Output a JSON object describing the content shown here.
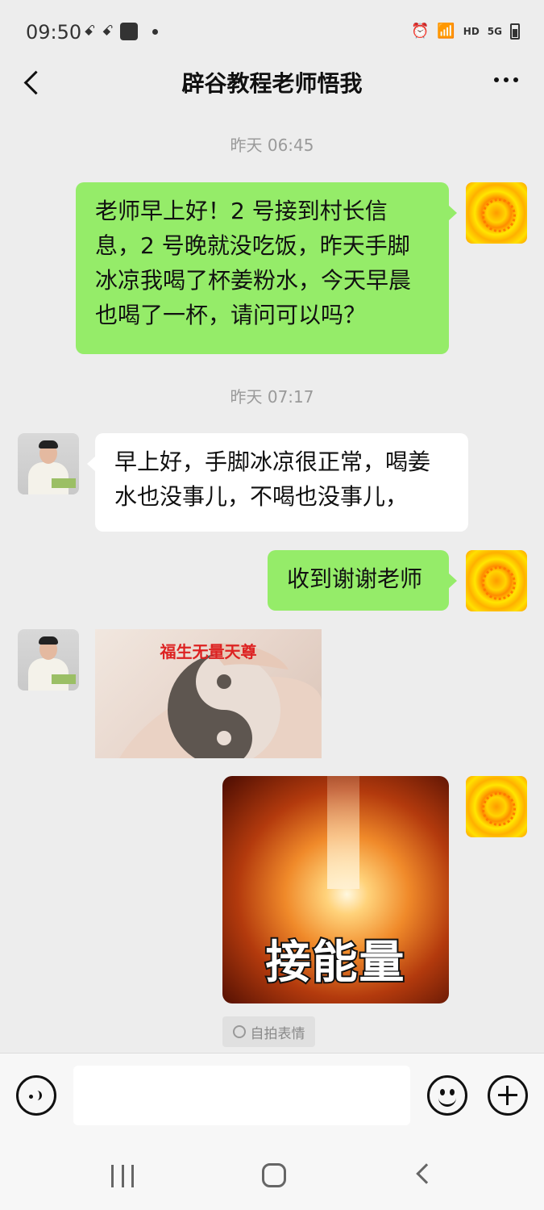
{
  "status_bar": {
    "time": "09:50",
    "left_icons": [
      "ꗃ",
      "ꗃ"
    ],
    "network": "HD",
    "signal": "5G"
  },
  "header": {
    "title": "辟谷教程老师悟我"
  },
  "messages": [
    {
      "timestamp": "昨天 06:45"
    },
    {
      "text": "老师早上好！2 号接到村长信息，2 号晚就没吃饭，昨天手脚冰凉我喝了杯姜粉水，今天早晨也喝了一杯，请问可以吗？"
    },
    {
      "timestamp": "昨天 07:17"
    },
    {
      "text": "早上好，手脚冰凉很正常，喝姜水也没事儿，不喝也没事儿，"
    },
    {
      "text": "收到谢谢老师"
    },
    {
      "caption": "福生无量天尊"
    },
    {
      "caption": "接能量"
    }
  ],
  "selfie_chip": {
    "label": "自拍表情"
  },
  "input": {
    "placeholder": ""
  }
}
